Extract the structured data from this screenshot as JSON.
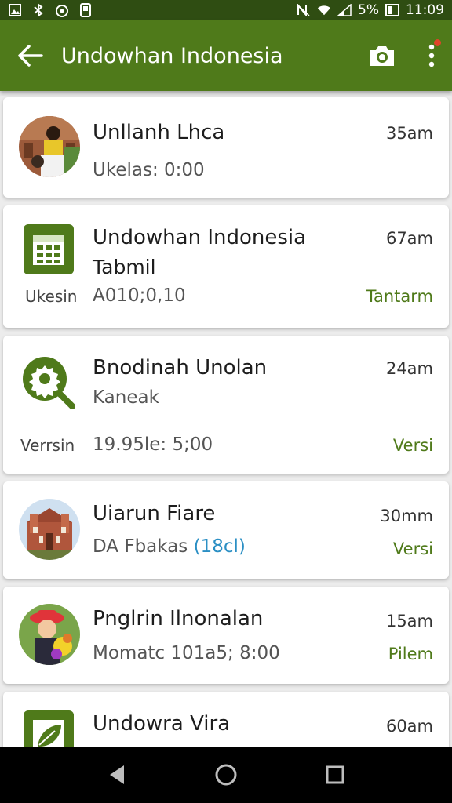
{
  "status_bar": {
    "battery": "5%",
    "time": "11:09"
  },
  "app_bar": {
    "title": "Undowhan Indonesia"
  },
  "items": [
    {
      "title": "Unllanh Lhca",
      "subtitle": "Ukelas: 0:00",
      "time": "35am"
    },
    {
      "title": "Undowhan Indonesia",
      "subtitle": "Tabmil",
      "time": "67am",
      "side_label": "Ukesin",
      "detail": "A010;0,10",
      "badge": "Tantarm"
    },
    {
      "title": "Bnodinah Unolan",
      "subtitle": "Kaneak",
      "time": "24am",
      "side_label": "Verrsin",
      "detail": "19.95le: 5;00",
      "badge": "Versi"
    },
    {
      "title": "Uiarun Fiare",
      "subtitle": "DA Fbakas",
      "tag": "(18cl)",
      "time": "30mm",
      "badge": "Versi"
    },
    {
      "title": "Pnglrin Ilnonalan",
      "subtitle": "Momatc 101a5; 8:00",
      "time": "15am",
      "badge": "Pilem"
    },
    {
      "title": "Undowra Vira",
      "time": "60am"
    }
  ],
  "colors": {
    "primary": "#4f7a1a",
    "status_bar": "#2f4d12",
    "tag": "#2b8fc4",
    "notification": "#e0442a"
  }
}
